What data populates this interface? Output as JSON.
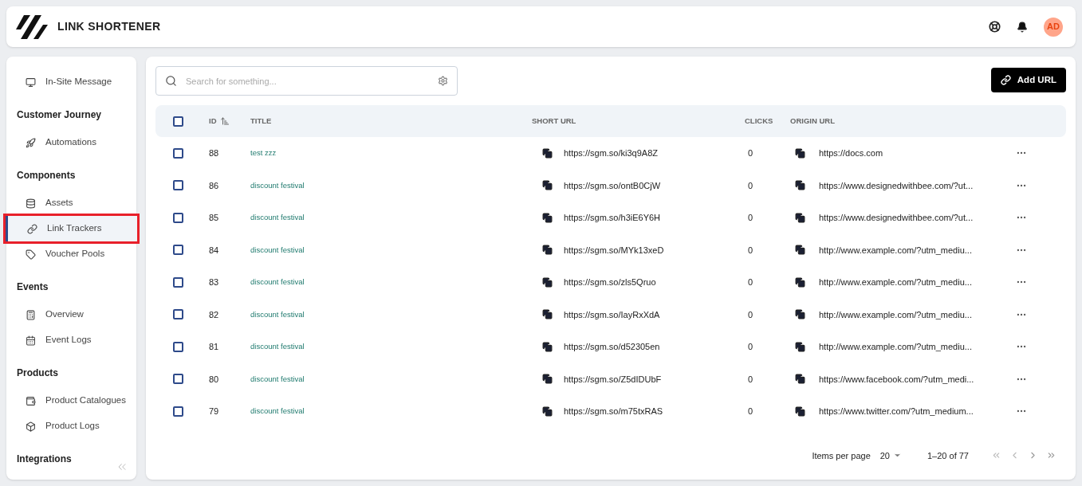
{
  "header": {
    "title": "LINK SHORTENER",
    "avatar": "AD"
  },
  "sidebar": {
    "groups": [
      {
        "items": [
          {
            "label": "In-Site Message",
            "selected": false
          }
        ]
      },
      {
        "heading": "Customer Journey",
        "items": [
          {
            "label": "Automations",
            "selected": false
          }
        ]
      },
      {
        "heading": "Components",
        "items": [
          {
            "label": "Assets",
            "selected": false
          },
          {
            "label": "Link Trackers",
            "selected": true
          },
          {
            "label": "Voucher Pools",
            "selected": false
          }
        ]
      },
      {
        "heading": "Events",
        "items": [
          {
            "label": "Overview",
            "selected": false
          },
          {
            "label": "Event Logs",
            "selected": false
          }
        ]
      },
      {
        "heading": "Products",
        "items": [
          {
            "label": "Product Catalogues",
            "selected": false
          },
          {
            "label": "Product Logs",
            "selected": false
          }
        ]
      },
      {
        "heading": "Integrations"
      }
    ]
  },
  "search": {
    "placeholder": "Search for something..."
  },
  "add_button": "Add URL",
  "table": {
    "all_checked": false,
    "columns": [
      "ID",
      "TITLE",
      "SHORT URL",
      "CLICKS",
      "ORIGIN URL"
    ],
    "rows": [
      {
        "checked": false,
        "id": "88",
        "title": "test zzz",
        "short_url": "https://sgm.so/ki3q9A8Z",
        "clicks": "0",
        "origin_url": "https://docs.com"
      },
      {
        "checked": false,
        "id": "86",
        "title": "discount festival",
        "short_url": "https://sgm.so/ontB0CjW",
        "clicks": "0",
        "origin_url": "https://www.designedwithbee.com/?ut..."
      },
      {
        "checked": false,
        "id": "85",
        "title": "discount festival",
        "short_url": "https://sgm.so/h3iE6Y6H",
        "clicks": "0",
        "origin_url": "https://www.designedwithbee.com/?ut..."
      },
      {
        "checked": false,
        "id": "84",
        "title": "discount festival",
        "short_url": "https://sgm.so/MYk13xeD",
        "clicks": "0",
        "origin_url": "http://www.example.com/?utm_mediu..."
      },
      {
        "checked": false,
        "id": "83",
        "title": "discount festival",
        "short_url": "https://sgm.so/zls5Qruo",
        "clicks": "0",
        "origin_url": "http://www.example.com/?utm_mediu..."
      },
      {
        "checked": false,
        "id": "82",
        "title": "discount festival",
        "short_url": "https://sgm.so/IayRxXdA",
        "clicks": "0",
        "origin_url": "http://www.example.com/?utm_mediu..."
      },
      {
        "checked": false,
        "id": "81",
        "title": "discount festival",
        "short_url": "https://sgm.so/d52305en",
        "clicks": "0",
        "origin_url": "http://www.example.com/?utm_mediu..."
      },
      {
        "checked": false,
        "id": "80",
        "title": "discount festival",
        "short_url": "https://sgm.so/Z5dIDUbF",
        "clicks": "0",
        "origin_url": "https://www.facebook.com/?utm_medi..."
      },
      {
        "checked": false,
        "id": "79",
        "title": "discount festival",
        "short_url": "https://sgm.so/m75txRAS",
        "clicks": "0",
        "origin_url": "https://www.twitter.com/?utm_medium..."
      }
    ]
  },
  "pagination": {
    "label": "Items per page",
    "page_size": "20",
    "range": "1–20 of 77"
  }
}
